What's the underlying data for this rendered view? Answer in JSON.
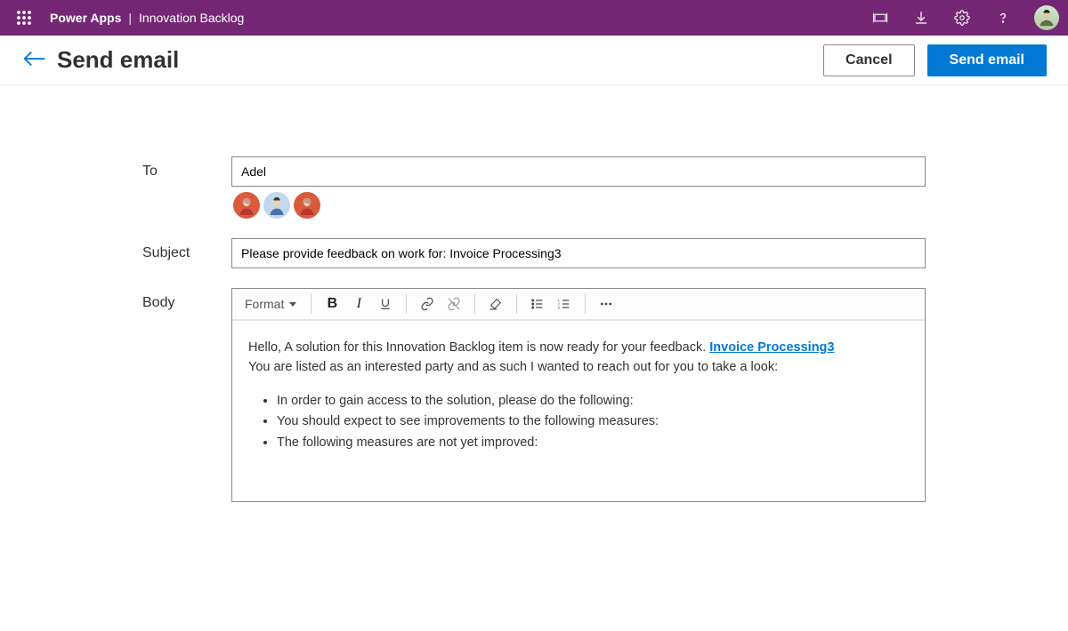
{
  "topbar": {
    "product": "Power Apps",
    "separator": "|",
    "app": "Innovation Backlog"
  },
  "page": {
    "title": "Send email",
    "cancel": "Cancel",
    "send": "Send email"
  },
  "form": {
    "to_label": "To",
    "to_value": "Adel",
    "subject_label": "Subject",
    "subject_value": "Please provide feedback on work for: Invoice Processing3",
    "body_label": "Body",
    "format_label": "Format"
  },
  "body": {
    "line1_a": "Hello, A solution for this Innovation Backlog item is now ready for your feedback. ",
    "line1_link": "Invoice Processing3",
    "line2": "You are listed as an interested party and as such I wanted to reach out for you to take a look:",
    "bullets": [
      "In order to gain access to the solution, please do the following:",
      "You should expect to see improvements to the following measures:",
      "The following measures are not yet improved:"
    ]
  }
}
